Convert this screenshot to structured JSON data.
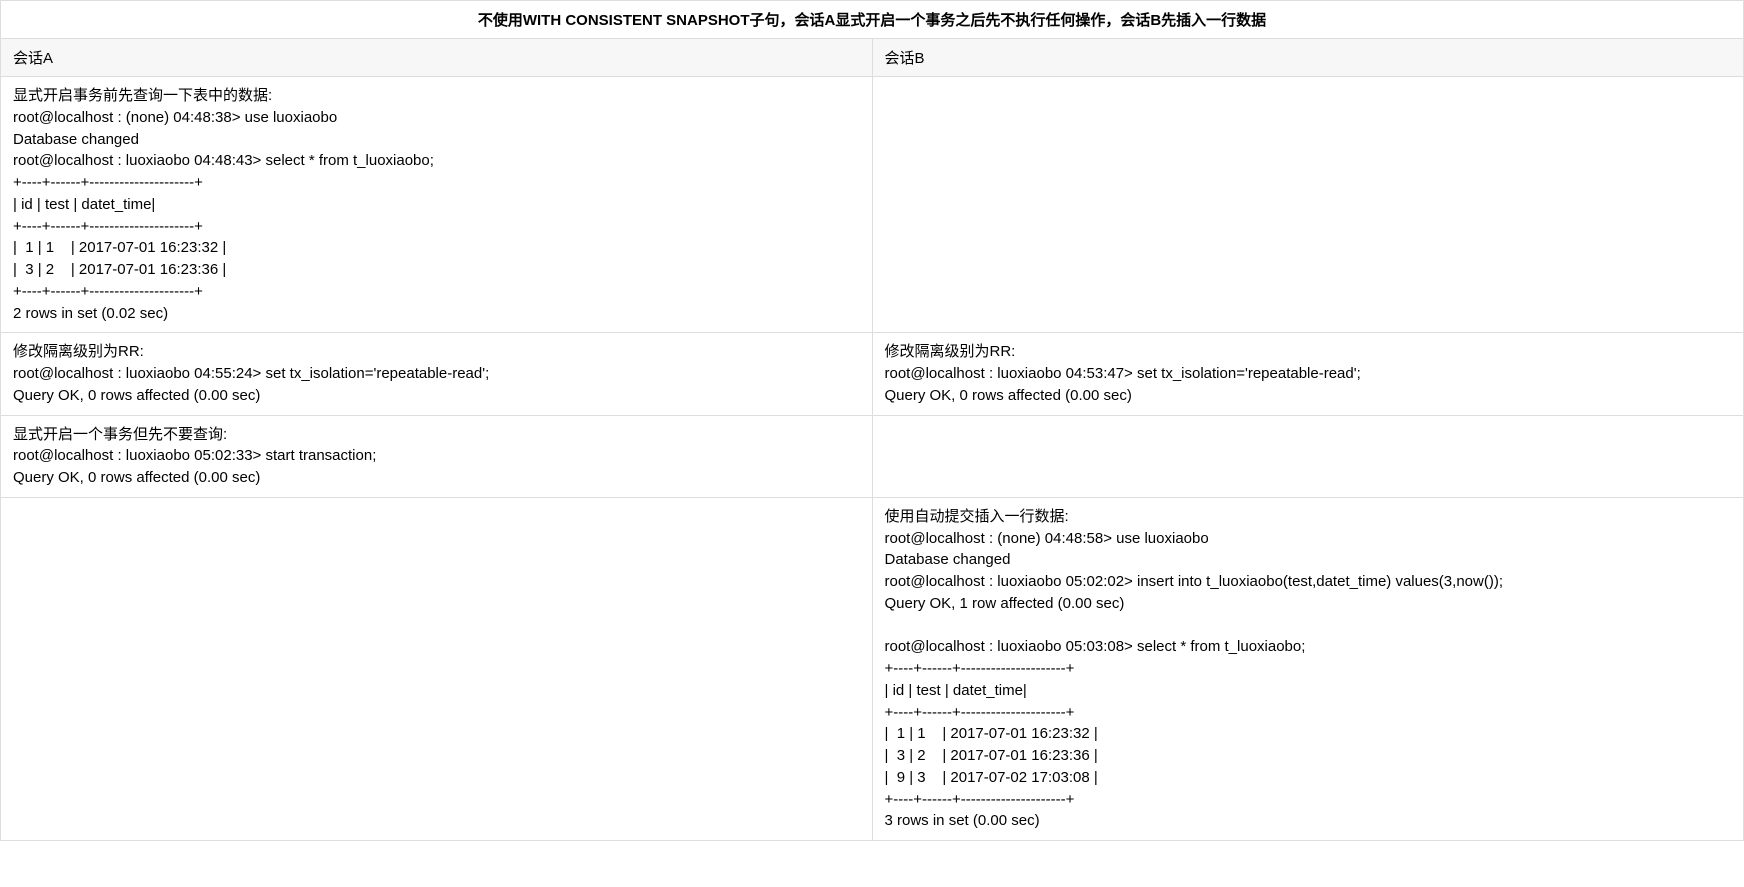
{
  "title": "不使用WITH CONSISTENT SNAPSHOT子句，会话A显式开启一个事务之后先不执行任何操作，会话B先插入一行数据",
  "headers": {
    "colA": "会话A",
    "colB": "会话B"
  },
  "rows": [
    {
      "a": "显式开启事务前先查询一下表中的数据:\nroot@localhost : (none) 04:48:38> use luoxiaobo\nDatabase changed\nroot@localhost : luoxiaobo 04:48:43> select * from t_luoxiaobo;\n+----+------+---------------------+\n| id | test | datet_time|\n+----+------+---------------------+\n|  1 | 1    | 2017-07-01 16:23:32 |\n|  3 | 2    | 2017-07-01 16:23:36 |\n+----+------+---------------------+\n2 rows in set (0.02 sec)",
      "b": ""
    },
    {
      "a": "修改隔离级别为RR:\nroot@localhost : luoxiaobo 04:55:24> set tx_isolation='repeatable-read';\nQuery OK, 0 rows affected (0.00 sec)",
      "b": "修改隔离级别为RR:\nroot@localhost : luoxiaobo 04:53:47> set tx_isolation='repeatable-read';\nQuery OK, 0 rows affected (0.00 sec)"
    },
    {
      "a": "显式开启一个事务但先不要查询:\nroot@localhost : luoxiaobo 05:02:33> start transaction;\nQuery OK, 0 rows affected (0.00 sec)",
      "b": ""
    },
    {
      "a": "",
      "b": "使用自动提交插入一行数据:\nroot@localhost : (none) 04:48:58> use luoxiaobo\nDatabase changed\nroot@localhost : luoxiaobo 05:02:02> insert into t_luoxiaobo(test,datet_time) values(3,now());\nQuery OK, 1 row affected (0.00 sec)\n\nroot@localhost : luoxiaobo 05:03:08> select * from t_luoxiaobo;\n+----+------+---------------------+\n| id | test | datet_time|\n+----+------+---------------------+\n|  1 | 1    | 2017-07-01 16:23:32 |\n|  3 | 2    | 2017-07-01 16:23:36 |\n|  9 | 3    | 2017-07-02 17:03:08 |\n+----+------+---------------------+\n3 rows in set (0.00 sec)"
    }
  ]
}
